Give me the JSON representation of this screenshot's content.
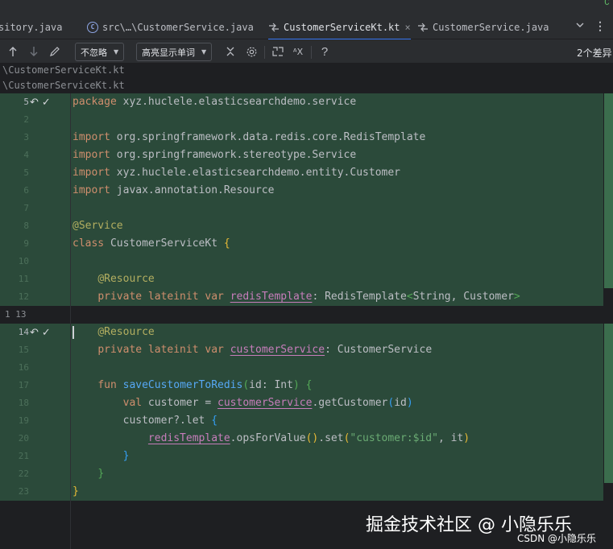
{
  "corner_glyph": "∁",
  "tabs": [
    {
      "label": "sitory.java",
      "icon": "",
      "active": false
    },
    {
      "label": "src\\…\\CustomerService.java",
      "icon": "java-class-icon",
      "active": false
    },
    {
      "label": "CustomerServiceKt.kt",
      "icon": "diff-icon",
      "active": true
    },
    {
      "label": "CustomerService.java",
      "icon": "diff-icon",
      "active": false
    }
  ],
  "toolbar": {
    "ignore_dropdown": "不忽略",
    "highlight_dropdown": "高亮显示单词",
    "diff_count": "2个差异"
  },
  "paths": [
    "\\CustomerServiceKt.kt",
    "\\CustomerServiceKt.kt"
  ],
  "editor": {
    "lines": [
      {
        "n": "5",
        "html": "<span class=\"kw\">package</span> xyz.huclele.elasticsearchdemo.service"
      },
      {
        "n": "2",
        "html": ""
      },
      {
        "n": "3",
        "html": "<span class=\"kw\">import</span> org.springframework.data.redis.core.RedisTemplate"
      },
      {
        "n": "4",
        "html": "<span class=\"kw\">import</span> org.springframework.stereotype.Service"
      },
      {
        "n": "5",
        "html": "<span class=\"kw\">import</span> xyz.huclele.elasticsearchdemo.entity.Customer"
      },
      {
        "n": "6",
        "html": "<span class=\"kw\">import</span> javax.annotation.Resource"
      },
      {
        "n": "7",
        "html": ""
      },
      {
        "n": "8",
        "html": "<span class=\"ann\">@Service</span>"
      },
      {
        "n": "9",
        "html": "<span class=\"kw\">class</span> CustomerServiceKt <span class=\"br1\">{</span>"
      },
      {
        "n": "10",
        "html": ""
      },
      {
        "n": "11",
        "html": "    <span class=\"ann\">@Resource</span>"
      },
      {
        "n": "12",
        "html": "    <span class=\"kw\">private lateinit var</span> <span class=\"prop\">redisTemplate</span>: RedisTemplate<span class=\"br2\">&lt;</span>String, Customer<span class=\"br2\">&gt;</span>"
      },
      {
        "n": "1 13",
        "html": ""
      },
      {
        "n": "14",
        "html": "    <span class=\"ann\">@Resource</span>"
      },
      {
        "n": "15",
        "html": "    <span class=\"kw\">private lateinit var</span> <span class=\"prop\">customerService</span>: CustomerService"
      },
      {
        "n": "16",
        "html": ""
      },
      {
        "n": "17",
        "html": "    <span class=\"kw\">fun</span> <span class=\"fn\">saveCustomerToRedis</span><span class=\"br2\">(</span>id: Int<span class=\"br2\">)</span> <span class=\"br2\">{</span>"
      },
      {
        "n": "18",
        "html": "        <span class=\"kw\">val</span> customer = <span class=\"prop\">customerService</span>.getCustomer<span class=\"br3\">(</span>id<span class=\"br3\">)</span>"
      },
      {
        "n": "19",
        "html": "        customer?.let <span class=\"br3\">{</span>"
      },
      {
        "n": "20",
        "html": "            <span class=\"prop\">redisTemplate</span>.opsForValue<span class=\"br1\">()</span>.set<span class=\"br1\">(</span><span class=\"str\">\"customer:$id\"</span>, it<span class=\"br1\">)</span>"
      },
      {
        "n": "21",
        "html": "        <span class=\"br3\">}</span>"
      },
      {
        "n": "22",
        "html": "    <span class=\"br2\">}</span>"
      },
      {
        "n": "23",
        "html": "<span class=\"br1\">}</span>"
      }
    ]
  },
  "watermark": {
    "main": "掘金技术社区 @ 小隐乐乐",
    "sub": "CSDN @小隐乐乐"
  },
  "colors": {
    "changed_block": "#2b4a3a",
    "change_marker": "#3b6d4d",
    "active_tab_underline": "#3574f0"
  }
}
